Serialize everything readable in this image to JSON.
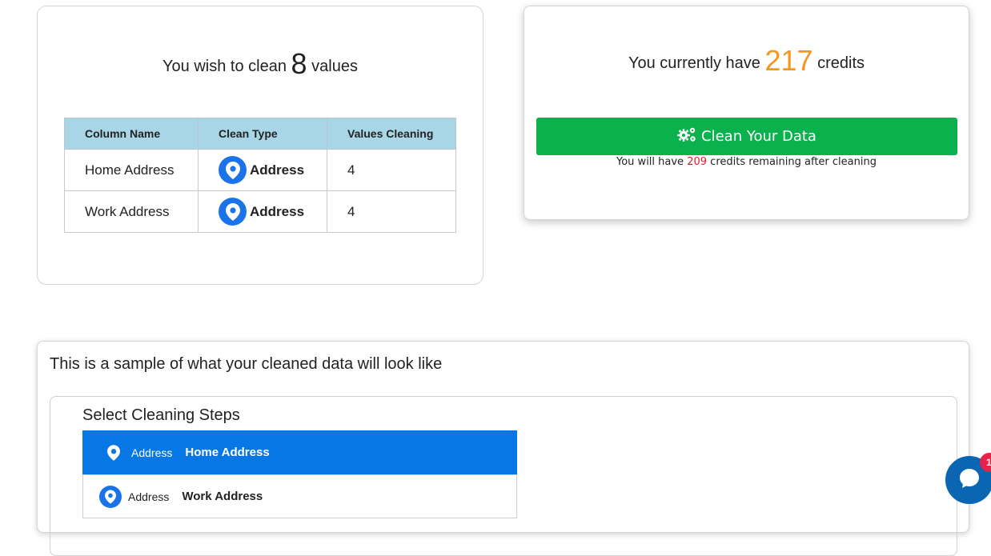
{
  "summary": {
    "prefix": "You wish to clean",
    "count": "8",
    "suffix": "values",
    "table": {
      "headers": [
        "Column Name",
        "Clean Type",
        "Values Cleaning"
      ],
      "rows": [
        {
          "column": "Home Address",
          "type": "Address",
          "values": "4"
        },
        {
          "column": "Work Address",
          "type": "Address",
          "values": "4"
        }
      ]
    }
  },
  "credits": {
    "prefix": "You currently have",
    "amount": "217",
    "suffix": "credits",
    "button_label": "Clean Your Data",
    "note_prefix": "You will have",
    "remaining": "209",
    "note_suffix": "credits remaining after cleaning",
    "amount_color": "#f7961e",
    "button_color": "#0bb14d"
  },
  "sample": {
    "title": "This is a sample of what your cleaned data will look like",
    "steps_title": "Select Cleaning Steps",
    "steps": [
      {
        "type": "Address",
        "column": "Home Address",
        "selected": true
      },
      {
        "type": "Address",
        "column": "Work Address",
        "selected": false
      }
    ],
    "selected_color": "#0777e6"
  },
  "chat": {
    "badge": "1",
    "icon": "chat-bubble-icon"
  }
}
